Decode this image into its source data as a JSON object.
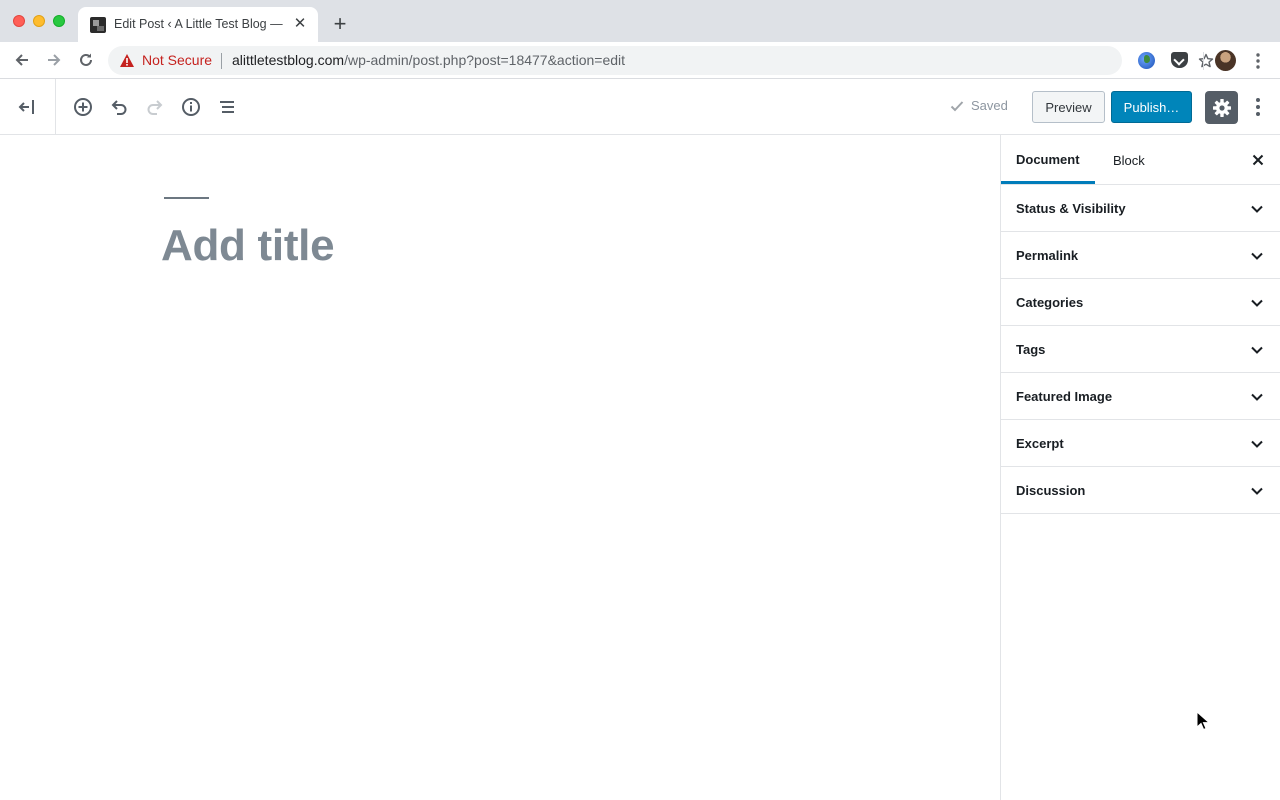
{
  "browser": {
    "tab_title": "Edit Post ‹ A Little Test Blog —",
    "security_label": "Not Secure",
    "url_host": "alittletestblog.com",
    "url_path": "/wp-admin/post.php?post=18477&action=edit"
  },
  "editor_header": {
    "status": "Saved",
    "preview_label": "Preview",
    "publish_label": "Publish…"
  },
  "canvas": {
    "title_placeholder": "Add title"
  },
  "sidebar": {
    "tabs": [
      {
        "label": "Document",
        "active": true
      },
      {
        "label": "Block",
        "active": false
      }
    ],
    "panels": [
      {
        "title": "Status & Visibility"
      },
      {
        "title": "Permalink"
      },
      {
        "title": "Categories"
      },
      {
        "title": "Tags"
      },
      {
        "title": "Featured Image"
      },
      {
        "title": "Excerpt"
      },
      {
        "title": "Discussion"
      }
    ]
  },
  "colors": {
    "publish": "#0085ba",
    "accent": "#007cba",
    "settings_active": "#555d66",
    "not_secure": "#c5221f"
  }
}
